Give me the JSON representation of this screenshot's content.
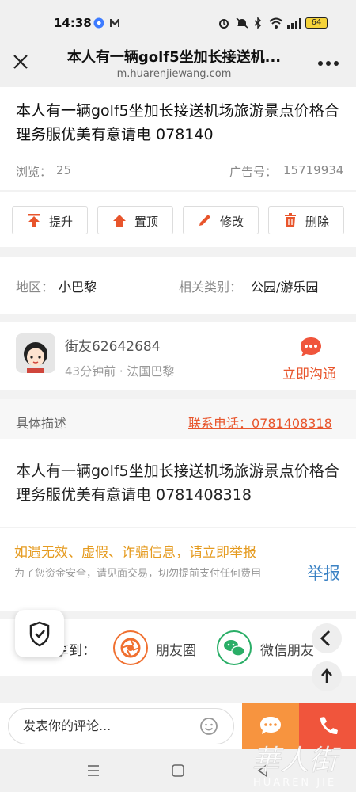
{
  "status_bar": {
    "time": "14:38",
    "battery": "64"
  },
  "browser": {
    "title": "本人有一辆golf5坐加长接送机...",
    "url": "m.huarenjiewang.com",
    "close_icon": "close-icon",
    "more_icon": "more-dots-icon"
  },
  "post": {
    "title": "本人有一辆golf5坐加长接送机场旅游景点价格合理务服优美有意请电 078140",
    "views_label": "浏览：",
    "views": "25",
    "ad_label": "广告号：",
    "ad_number": "15719934"
  },
  "actions": [
    {
      "label": "提升",
      "icon": "arrow-up-icon",
      "color": "#e8552c"
    },
    {
      "label": "置顶",
      "icon": "pin-top-icon",
      "color": "#e8552c"
    },
    {
      "label": "修改",
      "icon": "pencil-icon",
      "color": "#e8552c"
    },
    {
      "label": "删除",
      "icon": "trash-icon",
      "color": "#e8552c"
    }
  ],
  "info": {
    "region_label": "地区：",
    "region": "小巴黎",
    "category_label": "相关类别：",
    "category": "公园/游乐园"
  },
  "user": {
    "name": "街友62642684",
    "time_location": "43分钟前 · 法国巴黎",
    "chat_label": "立即沟通"
  },
  "description": {
    "label": "具体描述",
    "phone_link": "联系电话：0781408318",
    "body": "本人有一辆golf5坐加长接送机场旅游景点价格合理务服优美有意请电 0781408318"
  },
  "warning": {
    "headline": "如遇无效、虚假、诈骗信息，请立即举报",
    "detail": "为了您资金安全，请见面交易，切勿提前支付任何费用",
    "report_label": "举报"
  },
  "share": {
    "label": "享到：",
    "moments": "朋友圈",
    "wechat": "微信朋友"
  },
  "bottom": {
    "comment_placeholder": "发表你的评论..."
  },
  "watermark": {
    "cn": "華人街",
    "en": "HUAREN JIE"
  },
  "colors": {
    "accent": "#e8552c",
    "warning": "#e59b20",
    "link_blue": "#3b82c4",
    "msg_orange": "#f7943f",
    "call_red": "#f0553c"
  }
}
